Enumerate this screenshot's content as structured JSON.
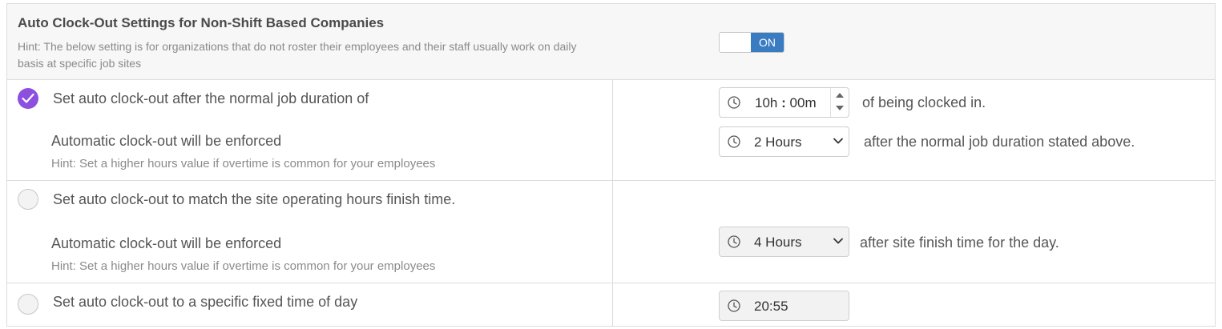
{
  "header": {
    "title": "Auto Clock-Out Settings for Non-Shift Based Companies",
    "hint": "Hint: The below setting is for organizations that do not roster their employees and their staff usually work on daily basis at specific job sites",
    "toggle_state": "ON"
  },
  "option1": {
    "label": "Set auto clock-out after the normal job duration of",
    "checked": true,
    "duration_hours": "10",
    "hours_unit": "h",
    "separator": ":",
    "duration_minutes": "00",
    "minutes_unit": "m",
    "duration_suffix": "of being clocked in.",
    "enforce_label": "Automatic clock-out will be enforced",
    "enforce_hint": "Hint: Set a higher hours value if overtime is common for your employees",
    "enforce_value": "2 Hours",
    "enforce_suffix": "after the normal job duration stated above."
  },
  "option2": {
    "label": "Set auto clock-out to match the site operating hours finish time.",
    "checked": false,
    "enforce_label": "Automatic clock-out will be enforced",
    "enforce_hint": "Hint: Set a higher hours value if overtime is common for your employees",
    "enforce_value": "4 Hours",
    "enforce_suffix": "after site finish time for the day."
  },
  "option3": {
    "label": "Set auto clock-out to a specific fixed time of day",
    "checked": false,
    "time_value": "20:55"
  },
  "colors": {
    "accent": "#8c4fe0",
    "toggle_on": "#3a7cc1"
  }
}
